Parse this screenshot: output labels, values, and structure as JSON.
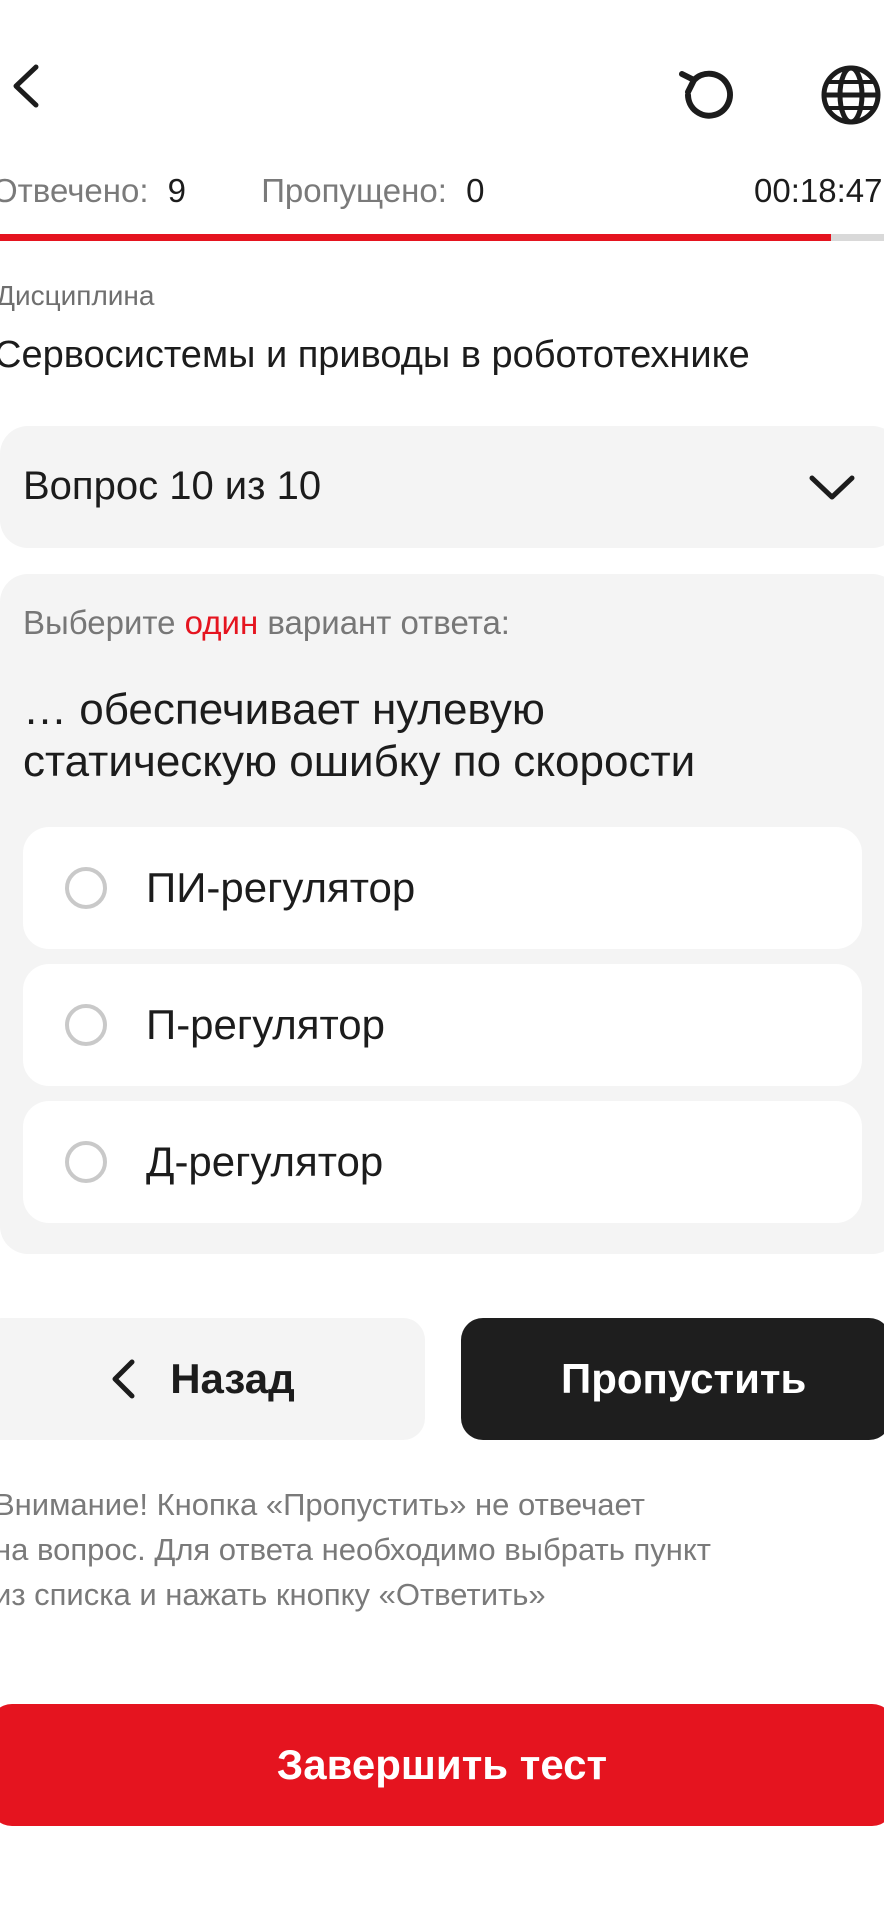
{
  "header": {
    "back_icon": "chevron-left-icon",
    "reset_icon": "reset-icon",
    "language_icon": "globe-icon"
  },
  "stats": {
    "answered_label": "Отвечено:",
    "answered_value": "9",
    "skipped_label": "Пропущено:",
    "skipped_value": "0",
    "timer": "00:18:47",
    "progress": 0.94,
    "progress_color": "#e5141f"
  },
  "discipline": {
    "label": "Дисциплина",
    "name": "Сервосистемы и приводы в робототехнике"
  },
  "question_selector": {
    "label": "Вопрос 10 из 10",
    "icon": "chevron-down-icon"
  },
  "question": {
    "instruction_prefix": "Выберите",
    "instruction_highlight": "один",
    "instruction_suffix": "вариант ответа:",
    "text_line1": "… обеспечивает нулевую",
    "text_line2": "статическую ошибку по скорости",
    "options": [
      {
        "label": "ПИ-регулятор",
        "selected": false
      },
      {
        "label": "П-регулятор",
        "selected": false
      },
      {
        "label": "Д-регулятор",
        "selected": false
      }
    ]
  },
  "nav": {
    "back_label": "Назад",
    "skip_label": "Пропустить"
  },
  "warning": {
    "line1": "Внимание! Кнопка «Пропустить» не отвечает",
    "line2": "на вопрос. Для ответа необходимо выбрать пункт",
    "line3": "из списка и нажать кнопку «Ответить»"
  },
  "finish": {
    "label": "Завершить тест",
    "color": "#e5141f"
  }
}
